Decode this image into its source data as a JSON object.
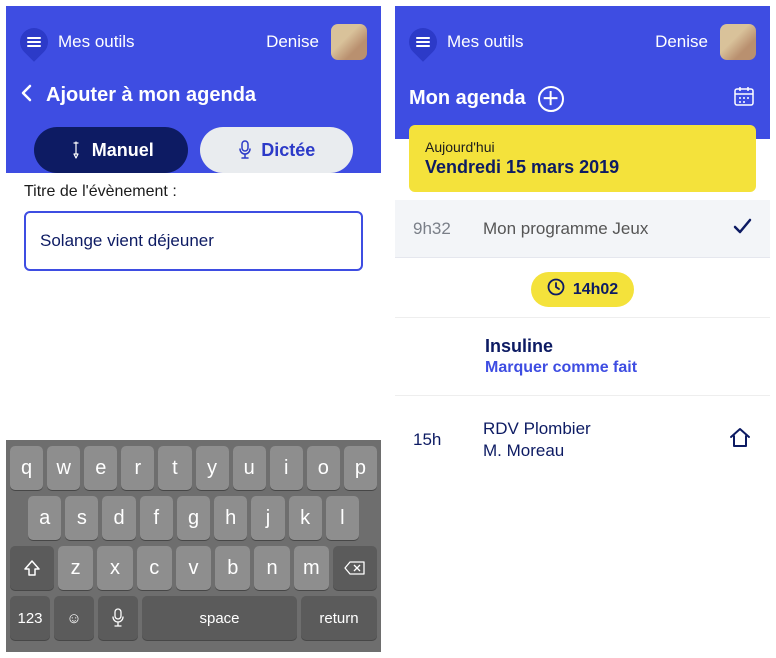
{
  "topbar": {
    "tools_label": "Mes outils",
    "user_name": "Denise"
  },
  "left_screen": {
    "page_title": "Ajouter à mon agenda",
    "tab_manual": "Manuel",
    "tab_dictee": "Dictée",
    "field_label": "Titre de l'évènement :",
    "event_title_value": "Solange vient déjeuner",
    "keyboard": {
      "row1": [
        "q",
        "w",
        "e",
        "r",
        "t",
        "y",
        "u",
        "i",
        "o",
        "p"
      ],
      "row2": [
        "a",
        "s",
        "d",
        "f",
        "g",
        "h",
        "j",
        "k",
        "l"
      ],
      "row3": [
        "z",
        "x",
        "c",
        "v",
        "b",
        "n",
        "m"
      ],
      "num_key": "123",
      "space_key": "space",
      "return_key": "return"
    }
  },
  "right_screen": {
    "agenda_title": "Mon agenda",
    "today_label": "Aujourd'hui",
    "today_date": "Vendredi 15 mars 2019",
    "completed_time": "9h32",
    "completed_label": "Mon programme Jeux",
    "current_time": "14h02",
    "task_title": "Insuline",
    "task_action": "Marquer comme fait",
    "appt_time": "15h",
    "appt_title": "RDV Plombier",
    "appt_subtitle": "M. Moreau"
  }
}
